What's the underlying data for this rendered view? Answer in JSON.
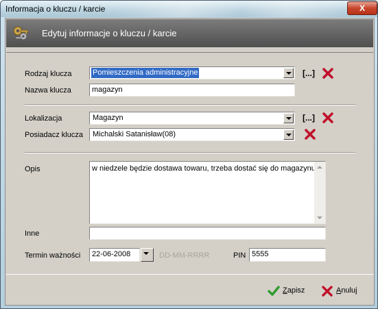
{
  "window": {
    "title": "Informacja o kluczu / karcie",
    "close_label": "X"
  },
  "header": {
    "text": "Edytuj informacje o kluczu / karcie"
  },
  "form": {
    "rodzaj": {
      "label": "Rodzaj klucza",
      "value": "Pomieszczenia administracyjne",
      "browse": "[...]"
    },
    "nazwa": {
      "label": "Nazwa klucza",
      "value": "magazyn"
    },
    "lokalizacja": {
      "label": "Lokalizacja",
      "value": "Magazyn",
      "browse": "[...]"
    },
    "posiadacz": {
      "label": "Posiadacz klucza",
      "value": "Michalski Satanisław(08)"
    },
    "opis": {
      "label": "Opis",
      "value": "w niedzele będzie dostawa towaru, trzeba dostać się do magazynu."
    },
    "inne": {
      "label": "Inne",
      "value": ""
    },
    "termin": {
      "label": "Termin ważności",
      "value": "22-06-2008",
      "format_hint": "DD-MM-RRRR"
    },
    "pin": {
      "label": "PIN",
      "value": "5555"
    }
  },
  "buttons": {
    "save": {
      "label_first": "Z",
      "label_rest": "apisz"
    },
    "cancel": {
      "label_first": "A",
      "label_rest": "nuluj"
    }
  },
  "colors": {
    "accent_red": "#c0102a",
    "accent_green": "#2e9b2e",
    "selection": "#316ac5"
  },
  "icons": {
    "header": "keys-icon",
    "clear": "red-x-icon",
    "save": "green-check-icon",
    "cancel": "red-x-icon"
  }
}
